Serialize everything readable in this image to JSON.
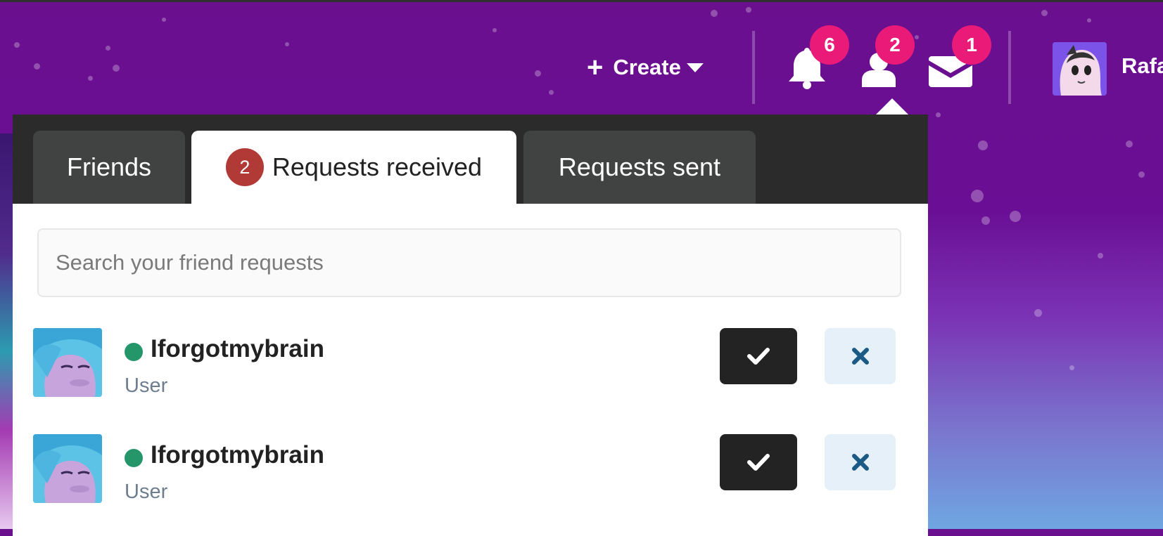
{
  "header": {
    "create_label": "Create",
    "notifications": {
      "count": "6",
      "icon": "bell-icon"
    },
    "friend_requests": {
      "count": "2",
      "icon": "user-icon"
    },
    "messages": {
      "count": "1",
      "icon": "envelope-icon"
    },
    "user_name": "Rafa"
  },
  "friends_panel": {
    "tabs": [
      {
        "label": "Friends",
        "active": false
      },
      {
        "label": "Requests received",
        "count": "2",
        "active": true
      },
      {
        "label": "Requests sent",
        "active": false
      }
    ],
    "search_placeholder": "Search your friend requests",
    "requests": [
      {
        "name": "Iforgotmybrain",
        "role": "User",
        "status": "online"
      },
      {
        "name": "Iforgotmybrain",
        "role": "User",
        "status": "online"
      }
    ]
  },
  "colors": {
    "badge": "#ea1a78",
    "tab_count": "#b13a36",
    "online": "#259669",
    "accept_button": "#232323",
    "reject_button": "#e6f0f8",
    "reject_icon": "#1c5a86"
  }
}
